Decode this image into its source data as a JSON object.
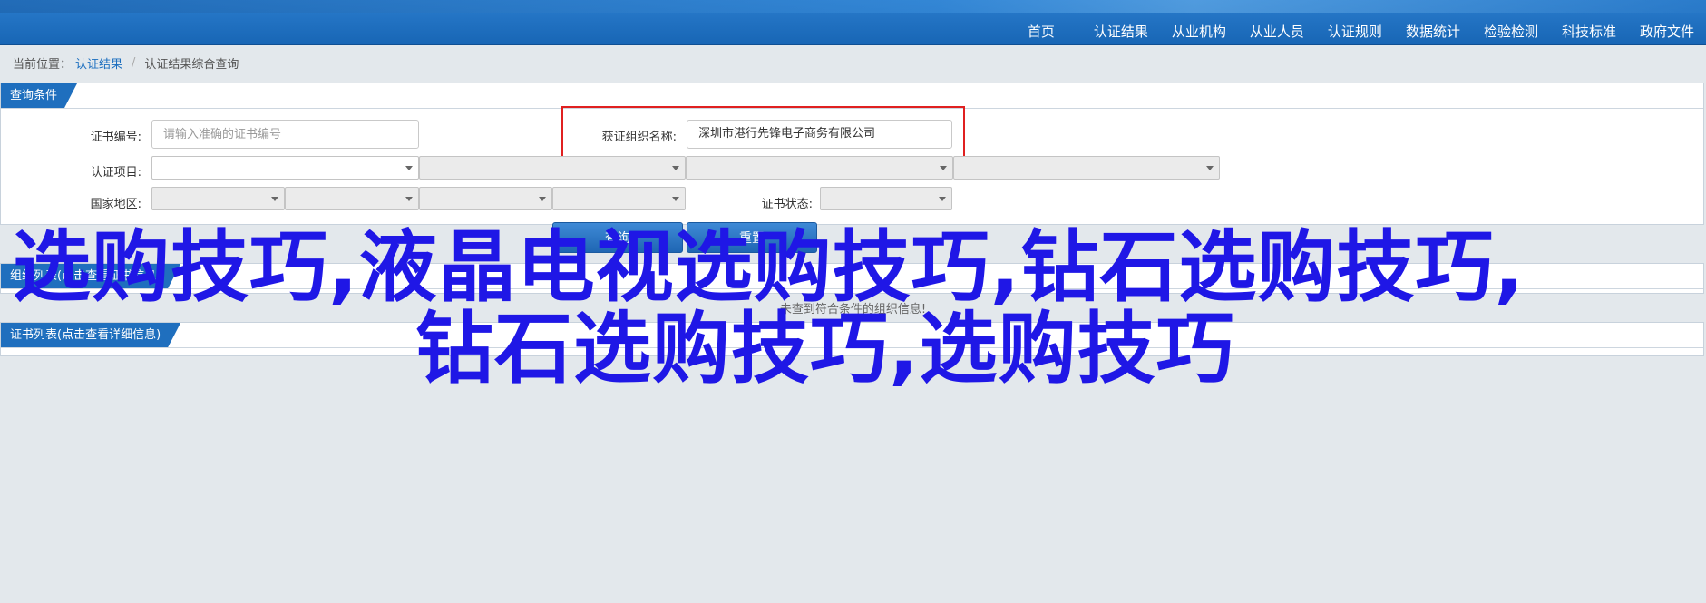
{
  "nav": {
    "items": [
      "首页",
      "认证结果",
      "从业机构",
      "从业人员",
      "认证规则",
      "数据统计",
      "检验检测",
      "科技标准",
      "政府文件"
    ]
  },
  "breadcrumb": {
    "prefix": "当前位置：",
    "link": "认证结果",
    "separator": "/",
    "current": "认证结果综合查询"
  },
  "query_panel": {
    "title": "查询条件",
    "cert_no_label": "证书编号:",
    "cert_no_placeholder": "请输入准确的证书编号",
    "org_label": "获证组织名称:",
    "org_value": "深圳市港行先锋电子商务有限公司",
    "project_label": "认证项目:",
    "region_label": "国家地区:",
    "status_label": "证书状态:",
    "query_button": "查询",
    "reset_button": "重置"
  },
  "org_panel": {
    "title": "组织列表(点击查看证书信息)",
    "empty_message": "未查到符合条件的组织信息!"
  },
  "cert_panel": {
    "title": "证书列表(点击查看详细信息)"
  },
  "overlay": {
    "line1": "选购技巧,液晶电视选购技巧,钻石选购技巧,",
    "line2": "钻石选购技巧,选购技巧"
  },
  "colors": {
    "nav_bar": "#1f6fbe",
    "overlay_text": "#1f17e6",
    "highlight_border": "#e02020"
  }
}
